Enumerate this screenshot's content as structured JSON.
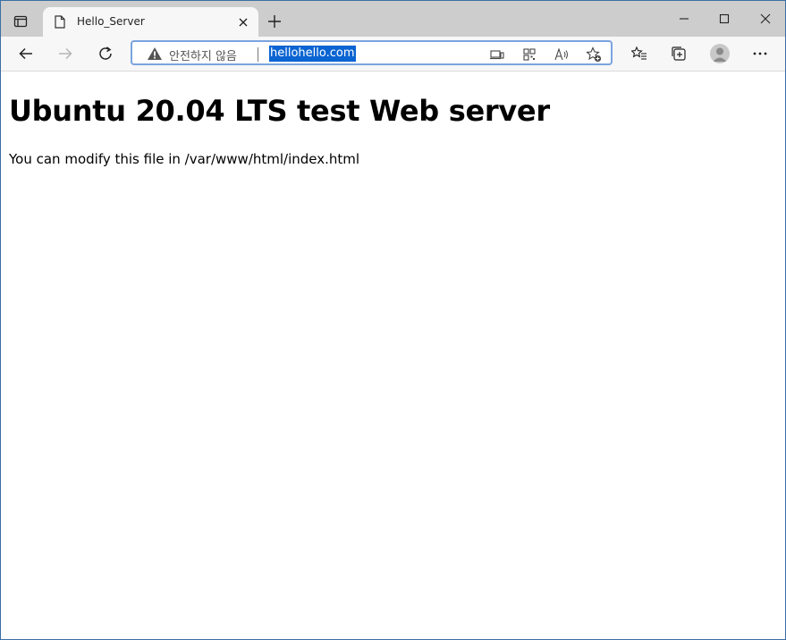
{
  "browser": {
    "tab": {
      "title": "Hello_Server",
      "favicon": "page-icon"
    },
    "window_controls": [
      "minimize-icon",
      "maximize-icon",
      "close-icon"
    ],
    "address_bar": {
      "security_label": "안전하지 않음",
      "url": "hellohello.com"
    },
    "colors": {
      "accent": "#0a64d2",
      "focus_border": "#7ba3e0",
      "tabbar_bg": "#cdcdcd"
    }
  },
  "page": {
    "heading": "Ubuntu 20.04 LTS test Web server",
    "paragraph": "You can modify this file in /var/www/html/index.html"
  }
}
